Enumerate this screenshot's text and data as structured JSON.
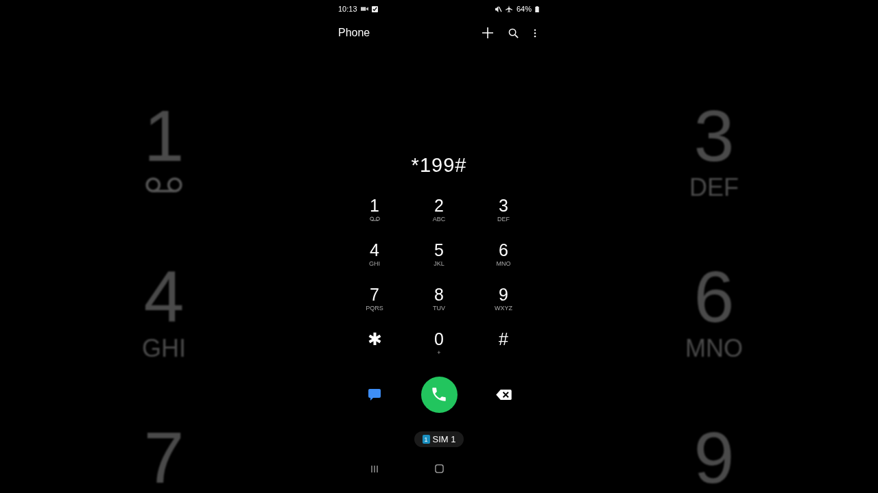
{
  "backdrop": {
    "left": [
      {
        "digit": "1",
        "voicemail": true
      },
      {
        "digit": "4",
        "letters": "GHI",
        "voicemail": false
      },
      {
        "digit": "7"
      }
    ],
    "right": [
      {
        "digit": "3",
        "letters": "DEF",
        "voicemail": false
      },
      {
        "digit": "6",
        "letters": "MNO",
        "voicemail": false
      },
      {
        "digit": "9"
      }
    ]
  },
  "status_bar": {
    "time": "10:13",
    "battery": "64%"
  },
  "app_bar": {
    "title": "Phone"
  },
  "dialed_number": "*199#",
  "keypad": [
    {
      "digit": "1",
      "voicemail": true
    },
    {
      "digit": "2",
      "letters": "ABC",
      "voicemail": false
    },
    {
      "digit": "3",
      "letters": "DEF",
      "voicemail": false
    },
    {
      "digit": "4",
      "letters": "GHI",
      "voicemail": false
    },
    {
      "digit": "5",
      "letters": "JKL",
      "voicemail": false
    },
    {
      "digit": "6",
      "letters": "MNO",
      "voicemail": false
    },
    {
      "digit": "7",
      "letters": "PQRS",
      "voicemail": false
    },
    {
      "digit": "8",
      "letters": "TUV",
      "voicemail": false
    },
    {
      "digit": "9",
      "letters": "WXYZ",
      "voicemail": false
    },
    {
      "digit": "✱",
      "voicemail": false
    },
    {
      "digit": "0",
      "letters": "+",
      "voicemail": false
    },
    {
      "digit": "#",
      "voicemail": false
    }
  ],
  "sim": {
    "number": "1",
    "label": "SIM 1"
  }
}
